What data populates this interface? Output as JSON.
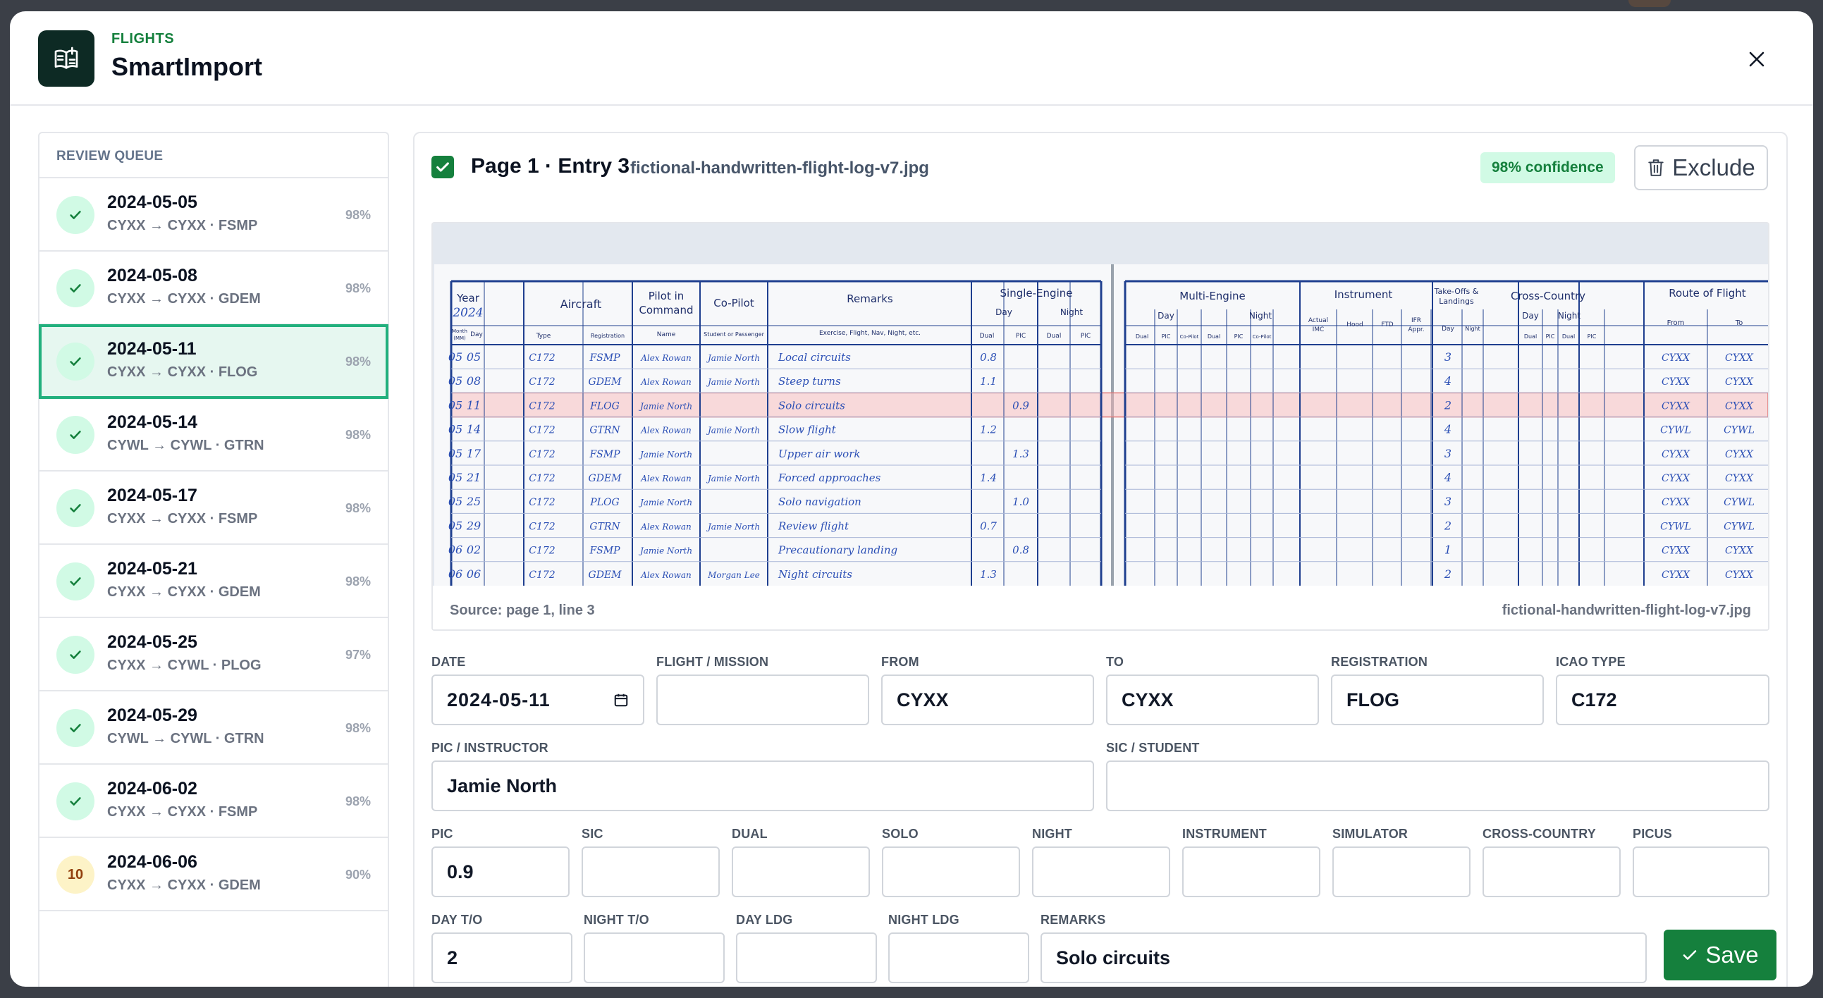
{
  "header": {
    "kicker": "FLIGHTS",
    "title": "SmartImport"
  },
  "queue": {
    "heading": "REVIEW QUEUE",
    "items": [
      {
        "badge": "",
        "date": "2024-05-05",
        "route": "CYXX → CYXX · FSMP",
        "confidence": "98%"
      },
      {
        "badge": "",
        "date": "2024-05-08",
        "route": "CYXX → CYXX · GDEM",
        "confidence": "98%"
      },
      {
        "badge": "",
        "date": "2024-05-11",
        "route": "CYXX → CYXX · FLOG",
        "confidence": "98%"
      },
      {
        "badge": "",
        "date": "2024-05-14",
        "route": "CYWL → CYWL · GTRN",
        "confidence": "98%"
      },
      {
        "badge": "",
        "date": "2024-05-17",
        "route": "CYXX → CYXX · FSMP",
        "confidence": "98%"
      },
      {
        "badge": "",
        "date": "2024-05-21",
        "route": "CYXX → CYXX · GDEM",
        "confidence": "98%"
      },
      {
        "badge": "",
        "date": "2024-05-25",
        "route": "CYXX → CYWL · PLOG",
        "confidence": "97%"
      },
      {
        "badge": "",
        "date": "2024-05-29",
        "route": "CYWL → CYWL · GTRN",
        "confidence": "98%"
      },
      {
        "badge": "",
        "date": "2024-06-02",
        "route": "CYXX → CYXX · FSMP",
        "confidence": "98%"
      },
      {
        "badge": "10",
        "date": "2024-06-06",
        "route": "CYXX → CYXX · GDEM",
        "confidence": "90%"
      }
    ]
  },
  "detail": {
    "title": "Page 1 · Entry 3",
    "file": "fictional-handwritten-flight-log-v7.jpg",
    "confidence": "98% confidence",
    "exclude_label": "Exclude",
    "source_left": "Source: page 1, line 3",
    "source_right": "fictional-handwritten-flight-log-v7.jpg",
    "save_label": "Save"
  },
  "logbook": {
    "year": "2024",
    "headers": {
      "year": "Year",
      "aircraft": "Aircraft",
      "pic": "Pilot in",
      "pic2": "Command",
      "copilot": "Co-Pilot",
      "remarks": "Remarks",
      "remarks_sub": "Exercise, Flight, Nav, Night, etc.",
      "single": "Single-Engine",
      "multi": "Multi-Engine",
      "instrument": "Instrument",
      "takeoffs": "Take-Offs &",
      "takeoffs2": "Landings",
      "xc": "Cross-Country",
      "route": "Route of Flight",
      "month": "Month",
      "mm": "(MM)",
      "day": "Day",
      "type": "Type",
      "reg": "Registration",
      "name": "Name",
      "student": "Student or Passenger",
      "se_day": "Day",
      "se_night": "Night",
      "dual": "Dual",
      "picc": "PIC",
      "co_pilot": "Co-Pilot",
      "actual": "Actual",
      "imc": "IMC",
      "hood": "Hood",
      "ftd": "FTD",
      "ifr": "IFR",
      "appr": "Appr.",
      "to_day": "Day",
      "to_night": "Night",
      "from": "From",
      "to": "To"
    },
    "rows": [
      {
        "m": "05",
        "d": "05",
        "type": "C172",
        "reg": "FSMP",
        "pic": "Alex Rowan",
        "co": "Jamie North",
        "rem": "Local circuits",
        "dual": "0.8",
        "spic": "",
        "ldg": "3",
        "from": "CYXX",
        "to": "CYXX"
      },
      {
        "m": "05",
        "d": "08",
        "type": "C172",
        "reg": "GDEM",
        "pic": "Alex Rowan",
        "co": "Jamie North",
        "rem": "Steep turns",
        "dual": "1.1",
        "spic": "",
        "ldg": "4",
        "from": "CYXX",
        "to": "CYXX"
      },
      {
        "m": "05",
        "d": "11",
        "type": "C172",
        "reg": "FLOG",
        "pic": "Jamie North",
        "co": "",
        "rem": "Solo circuits",
        "dual": "",
        "spic": "0.9",
        "ldg": "2",
        "from": "CYXX",
        "to": "CYXX"
      },
      {
        "m": "05",
        "d": "14",
        "type": "C172",
        "reg": "GTRN",
        "pic": "Alex Rowan",
        "co": "Jamie North",
        "rem": "Slow flight",
        "dual": "1.2",
        "spic": "",
        "ldg": "4",
        "from": "CYWL",
        "to": "CYWL"
      },
      {
        "m": "05",
        "d": "17",
        "type": "C172",
        "reg": "FSMP",
        "pic": "Jamie North",
        "co": "",
        "rem": "Upper air work",
        "dual": "",
        "spic": "1.3",
        "ldg": "3",
        "from": "CYXX",
        "to": "CYXX"
      },
      {
        "m": "05",
        "d": "21",
        "type": "C172",
        "reg": "GDEM",
        "pic": "Alex Rowan",
        "co": "Jamie North",
        "rem": "Forced approaches",
        "dual": "1.4",
        "spic": "",
        "ldg": "4",
        "from": "CYXX",
        "to": "CYXX"
      },
      {
        "m": "05",
        "d": "25",
        "type": "C172",
        "reg": "PLOG",
        "pic": "Jamie North",
        "co": "",
        "rem": "Solo navigation",
        "dual": "",
        "spic": "1.0",
        "ldg": "3",
        "from": "CYXX",
        "to": "CYWL"
      },
      {
        "m": "05",
        "d": "29",
        "type": "C172",
        "reg": "GTRN",
        "pic": "Alex Rowan",
        "co": "Jamie North",
        "rem": "Review flight",
        "dual": "0.7",
        "spic": "",
        "ldg": "2",
        "from": "CYWL",
        "to": "CYWL"
      },
      {
        "m": "06",
        "d": "02",
        "type": "C172",
        "reg": "FSMP",
        "pic": "Jamie North",
        "co": "",
        "rem": "Precautionary landing",
        "dual": "",
        "spic": "0.8",
        "ldg": "1",
        "from": "CYXX",
        "to": "CYXX"
      },
      {
        "m": "06",
        "d": "06",
        "type": "C172",
        "reg": "GDEM",
        "pic": "Alex Rowan",
        "co": "Morgan Lee",
        "rem": "Night circuits",
        "dual": "1.3",
        "spic": "",
        "ldg": "2",
        "from": "CYXX",
        "to": "CYXX"
      }
    ]
  },
  "form": {
    "labels": {
      "date": "DATE",
      "mission": "FLIGHT / MISSION",
      "from": "FROM",
      "to": "TO",
      "registration": "REGISTRATION",
      "icao": "ICAO TYPE",
      "pic_instructor": "PIC / INSTRUCTOR",
      "sic_student": "SIC / STUDENT",
      "pic": "PIC",
      "sic": "SIC",
      "dual": "DUAL",
      "solo": "SOLO",
      "night": "NIGHT",
      "instrument": "INSTRUMENT",
      "simulator": "SIMULATOR",
      "cross_country": "CROSS-COUNTRY",
      "picus": "PICUS",
      "day_to": "DAY T/O",
      "night_to": "NIGHT T/O",
      "day_ldg": "DAY LDG",
      "night_ldg": "NIGHT LDG",
      "remarks": "REMARKS"
    },
    "values": {
      "date": "2024-05-11",
      "mission": "",
      "from": "CYXX",
      "to": "CYXX",
      "registration": "FLOG",
      "icao": "C172",
      "pic_instructor": "Jamie North",
      "sic_student": "",
      "pic": "0.9",
      "sic": "",
      "dual": "",
      "solo": "",
      "night": "",
      "instrument": "",
      "simulator": "",
      "cross_country": "",
      "picus": "",
      "day_to": "2",
      "night_to": "",
      "day_ldg": "",
      "night_ldg": "",
      "remarks": "Solo circuits"
    }
  },
  "colors": {
    "accent": "#15803d",
    "selected_border": "#22b07d",
    "selected_bg": "#e6f7f0",
    "ink": "#2b4fb5",
    "grid": "#1f3f8f"
  }
}
